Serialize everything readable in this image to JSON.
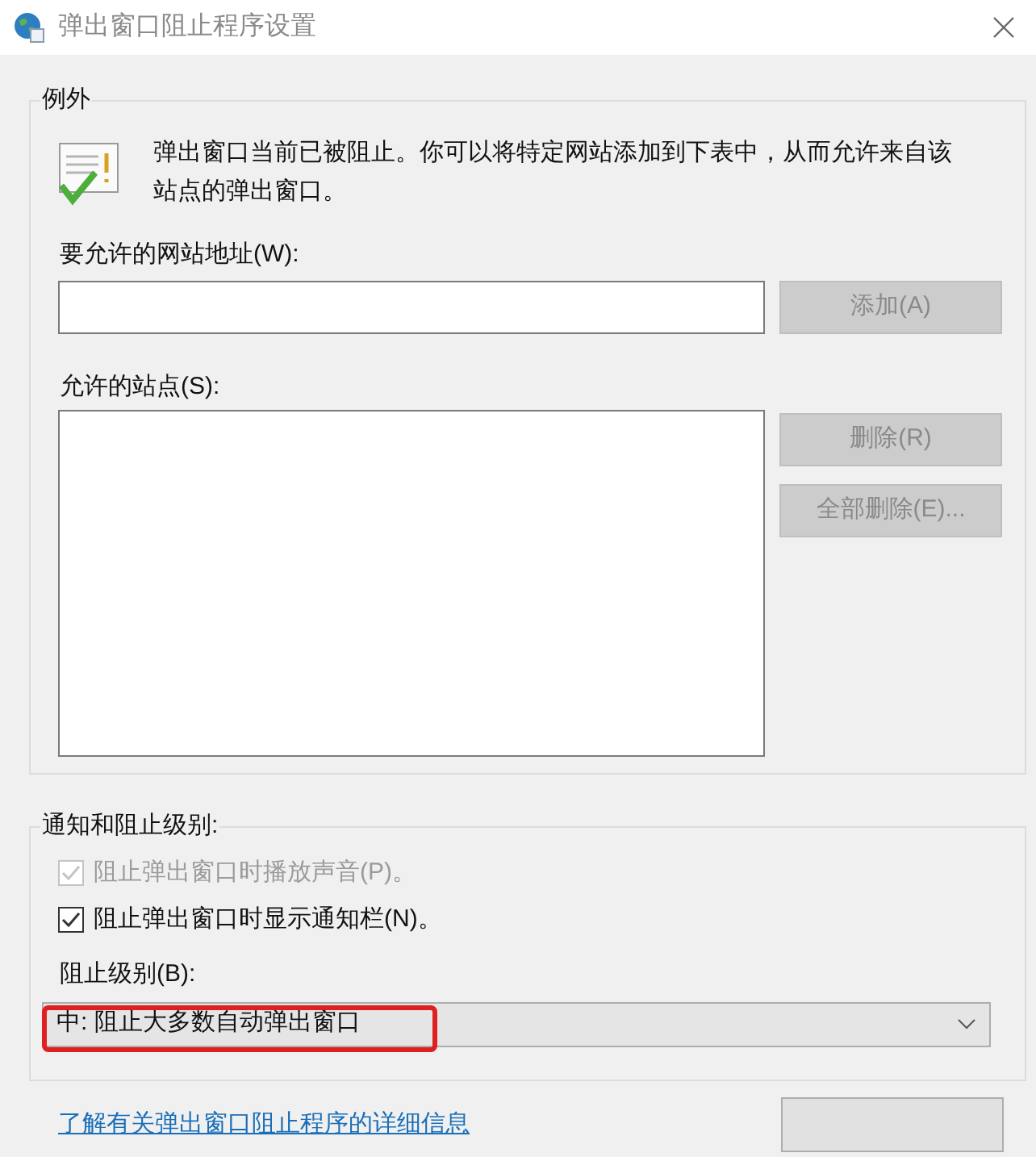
{
  "window": {
    "title": "弹出窗口阻止程序设置"
  },
  "exceptions": {
    "legend": "例外",
    "message": "弹出窗口当前已被阻止。你可以将特定网站添加到下表中，从而允许来自该站点的弹出窗口。",
    "address_label": "要允许的网站地址(W):",
    "add_button": {
      "label": "添加(A)",
      "disabled": true
    },
    "sites_label": "允许的站点(S):",
    "buttons": [
      {
        "label": "删除(R)",
        "disabled": true
      },
      {
        "label": "全部删除(E)...",
        "disabled": true
      }
    ]
  },
  "notifications": {
    "legend": "通知和阻止级别:",
    "options": [
      {
        "label": "阻止弹出窗口时播放声音(P)。",
        "checked": true,
        "disabled": true
      },
      {
        "label": "阻止弹出窗口时显示通知栏(N)。",
        "checked": true,
        "disabled": false
      }
    ],
    "level_label": "阻止级别(B):",
    "level_select": {
      "value": "中: 阻止大多数自动弹出窗口",
      "highlighted": true
    }
  },
  "footer": {
    "link": "了解有关弹出窗口阻止程序的详细信息"
  }
}
